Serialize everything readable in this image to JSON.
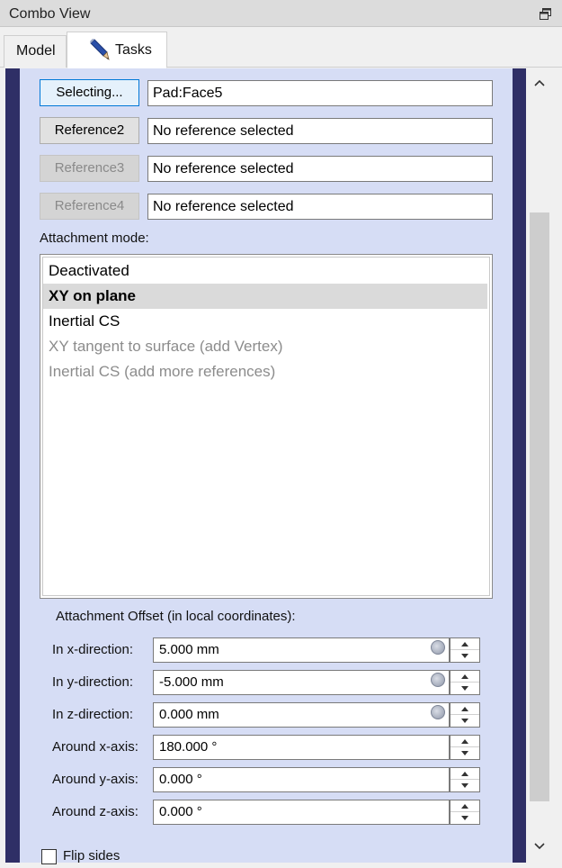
{
  "window": {
    "title": "Combo View"
  },
  "tabs": [
    {
      "label": "Model"
    },
    {
      "label": "Tasks"
    }
  ],
  "references": [
    {
      "button": "Selecting...",
      "value": "Pad:Face5",
      "state": "active"
    },
    {
      "button": "Reference2",
      "value": "No reference selected",
      "state": "enabled"
    },
    {
      "button": "Reference3",
      "value": "No reference selected",
      "state": "disabled"
    },
    {
      "button": "Reference4",
      "value": "No reference selected",
      "state": "disabled"
    }
  ],
  "attachment_mode": {
    "label": "Attachment mode:",
    "items": [
      {
        "label": "Deactivated",
        "state": "normal"
      },
      {
        "label": "XY on plane",
        "state": "selected"
      },
      {
        "label": "Inertial CS",
        "state": "normal"
      },
      {
        "label": "XY tangent to surface (add Vertex)",
        "state": "disabled"
      },
      {
        "label": "Inertial CS (add more references)",
        "state": "disabled"
      }
    ]
  },
  "offset": {
    "title": "Attachment Offset (in local coordinates):",
    "fields": [
      {
        "label": "In x-direction:",
        "value": "5.000 mm",
        "has_expr": true
      },
      {
        "label": "In y-direction:",
        "value": "-5.000 mm",
        "has_expr": true
      },
      {
        "label": "In z-direction:",
        "value": "0.000 mm",
        "has_expr": true
      },
      {
        "label": "Around x-axis:",
        "value": "180.000 °",
        "has_expr": false
      },
      {
        "label": "Around y-axis:",
        "value": "0.000 °",
        "has_expr": false
      },
      {
        "label": "Around z-axis:",
        "value": "0.000 °",
        "has_expr": false
      }
    ]
  },
  "flip_sides": {
    "label": "Flip sides",
    "checked": false
  },
  "colors": {
    "panel_bg": "#d6ddf5",
    "panel_frame": "#2f2f66",
    "active_button": "#e5f1fb",
    "active_border": "#0078d7"
  },
  "icons": {
    "float": "float-window-icon",
    "tasks": "pencil-icon",
    "expression": "expression-binding-icon"
  }
}
